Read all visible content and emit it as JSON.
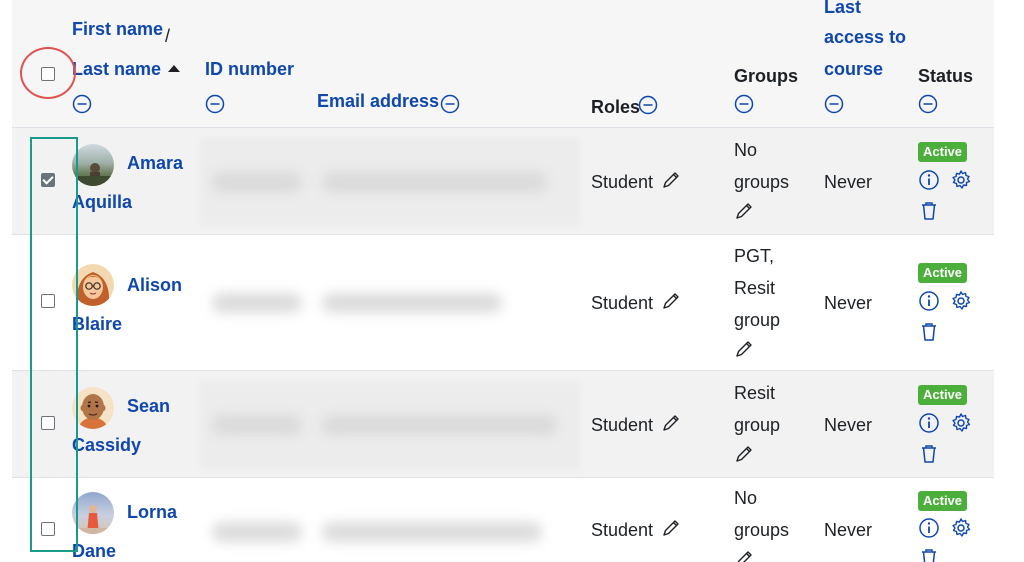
{
  "header": {
    "first_name": "First name",
    "slash": "/",
    "last_name": "Last name",
    "id_number": "ID number",
    "email": "Email address",
    "roles": "Roles",
    "groups": "Groups",
    "last_access_line1": "Last",
    "last_access_line2": "access to",
    "last_access_line3": "course",
    "status": "Status"
  },
  "rows": [
    {
      "first": "Amara",
      "last": "Aquilla",
      "checked": true,
      "role": "Student",
      "groups_lines": [
        "No",
        "groups"
      ],
      "last_access": "Never",
      "status": "Active"
    },
    {
      "first": "Alison",
      "last": "Blaire",
      "checked": false,
      "role": "Student",
      "groups_lines": [
        "PGT,",
        "Resit",
        "group"
      ],
      "last_access": "Never",
      "status": "Active"
    },
    {
      "first": "Sean",
      "last": "Cassidy",
      "checked": false,
      "role": "Student",
      "groups_lines": [
        "Resit",
        "group"
      ],
      "last_access": "Never",
      "status": "Active"
    },
    {
      "first": "Lorna",
      "last": "Dane",
      "checked": false,
      "role": "Student",
      "groups_lines": [
        "No",
        "groups"
      ],
      "last_access": "Never",
      "status": "Active"
    }
  ],
  "colors": {
    "link": "#0f47ad",
    "active_badge": "#4caf3c",
    "select_all_highlight": "#e05252",
    "select_column_highlight": "#1a9a8a"
  }
}
